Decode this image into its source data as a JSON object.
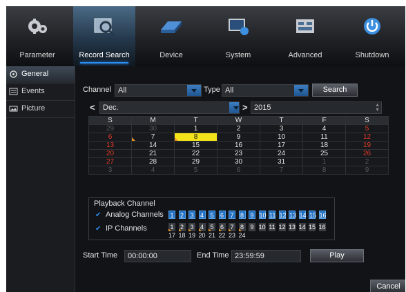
{
  "tabs": [
    {
      "label": "Parameter",
      "icon": "gears-icon"
    },
    {
      "label": "Record Search",
      "icon": "record-search-icon"
    },
    {
      "label": "Device",
      "icon": "hard-drive-icon"
    },
    {
      "label": "System",
      "icon": "system-monitor-icon"
    },
    {
      "label": "Advanced",
      "icon": "advanced-panel-icon"
    },
    {
      "label": "Shutdown",
      "icon": "power-icon"
    }
  ],
  "sidebar": [
    {
      "label": "General",
      "icon": "general-icon"
    },
    {
      "label": "Events",
      "icon": "events-icon"
    },
    {
      "label": "Picture",
      "icon": "picture-icon"
    }
  ],
  "filters": {
    "channel_label": "Channel",
    "channel_value": "All",
    "type_label": "Type",
    "type_value": "All",
    "search_button": "Search"
  },
  "calendar": {
    "prev_glyph": "<",
    "month": "Dec.",
    "next_glyph": ">",
    "year": "2015",
    "weekdays": [
      "S",
      "M",
      "T",
      "W",
      "T",
      "F",
      "S"
    ],
    "weeks": [
      [
        "29",
        "30",
        "1",
        "2",
        "3",
        "4",
        "5"
      ],
      [
        "6",
        "7",
        "8",
        "9",
        "10",
        "11",
        "12"
      ],
      [
        "13",
        "14",
        "15",
        "16",
        "17",
        "18",
        "19"
      ],
      [
        "20",
        "21",
        "22",
        "23",
        "24",
        "25",
        "26"
      ],
      [
        "27",
        "28",
        "29",
        "30",
        "31",
        "1",
        "2"
      ],
      [
        "3",
        "4",
        "5",
        "6",
        "7",
        "8",
        "9"
      ]
    ],
    "selected_day": "8"
  },
  "playback": {
    "title": "Playback Channel",
    "analog_label": "Analog Channels",
    "ip_label": "IP Channels",
    "analog_channels": [
      "1",
      "2",
      "3",
      "4",
      "5",
      "6",
      "7",
      "8",
      "9",
      "10",
      "11",
      "12",
      "13",
      "14",
      "15",
      "16"
    ],
    "ip_channels_row1": [
      "1",
      "2",
      "3",
      "4",
      "5",
      "6",
      "7",
      "8",
      "9",
      "10",
      "11",
      "12",
      "13",
      "14",
      "15",
      "16"
    ],
    "ip_channels_row2": [
      "17",
      "18",
      "19",
      "20",
      "21",
      "22",
      "23",
      "24"
    ]
  },
  "time": {
    "start_label": "Start Time",
    "start_value": "00:00:00",
    "end_label": "End Time",
    "end_value": "23:59:59",
    "play_button": "Play"
  },
  "cancel_button": "Cancel",
  "colors": {
    "accent": "#2d8cf0",
    "selected_day": "#f2e21a",
    "weekend_text": "#e23b2a",
    "record_marker": "#e89220"
  }
}
